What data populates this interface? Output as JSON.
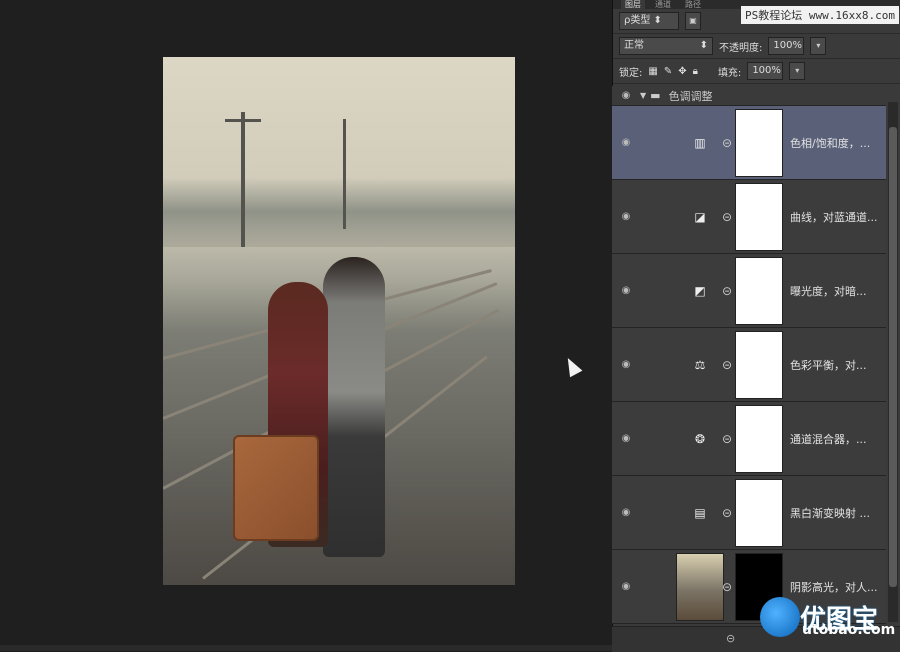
{
  "panel": {
    "tabs": [
      "图层",
      "通道",
      "路径"
    ],
    "filter_label": "ρ类型",
    "watermark": "PS教程论坛 www.16xx8.com",
    "blend_mode": "正常",
    "opacity_label": "不透明度:",
    "opacity_value": "100%",
    "lock_label": "锁定:",
    "fill_label": "填充:",
    "fill_value": "100%"
  },
  "layers": {
    "group_name": "色调调整",
    "items": [
      {
        "name": "色相/饱和度，...",
        "icon": "hue-saturation-icon",
        "selected": true
      },
      {
        "name": "曲线，对蓝通道...",
        "icon": "curves-icon",
        "selected": false
      },
      {
        "name": "曝光度，对暗...",
        "icon": "exposure-icon",
        "selected": false
      },
      {
        "name": "色彩平衡，对...",
        "icon": "color-balance-icon",
        "selected": false
      },
      {
        "name": "通道混合器，...",
        "icon": "channel-mixer-icon",
        "selected": false
      },
      {
        "name": "黑白渐变映射 ...",
        "icon": "gradient-map-icon",
        "selected": false
      },
      {
        "name": "阴影高光，对人...",
        "icon": "photo-thumbnail",
        "selected": false
      }
    ]
  },
  "logo": {
    "text_cn": "优图宝",
    "text_en": "utobao.com"
  }
}
